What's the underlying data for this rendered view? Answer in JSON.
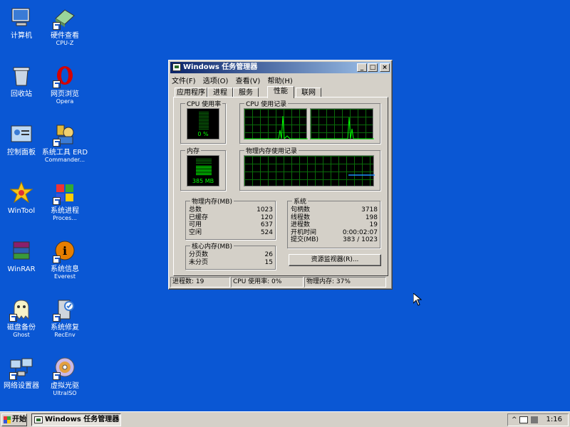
{
  "desktop_icons": [
    {
      "id": "computer",
      "label": "计算机",
      "sub": ""
    },
    {
      "id": "cpuz",
      "label": "硬件查看",
      "sub": "CPU-Z"
    },
    {
      "id": "recycle",
      "label": "回收站",
      "sub": ""
    },
    {
      "id": "opera",
      "label": "网页浏览",
      "sub": "Opera"
    },
    {
      "id": "control",
      "label": "控制面板",
      "sub": ""
    },
    {
      "id": "erd",
      "label": "系统工具 ERD",
      "sub": "Commander..."
    },
    {
      "id": "wintool",
      "label": "WinTool",
      "sub": ""
    },
    {
      "id": "proc",
      "label": "系统进程",
      "sub": "Proces..."
    },
    {
      "id": "winrar",
      "label": "WinRAR",
      "sub": ""
    },
    {
      "id": "everest",
      "label": "系统信息",
      "sub": "Everest"
    },
    {
      "id": "ghost",
      "label": "磁盘备份",
      "sub": "Ghost"
    },
    {
      "id": "recenv",
      "label": "系统修复",
      "sub": "RecEnv"
    },
    {
      "id": "network",
      "label": "网络设置器",
      "sub": ""
    },
    {
      "id": "ultraiso",
      "label": "虚拟光驱",
      "sub": "UltraISO"
    }
  ],
  "window": {
    "title": "Windows 任务管理器",
    "buttons": {
      "min": "_",
      "max": "□",
      "close": "×"
    },
    "menu": [
      "文件(F)",
      "选项(O)",
      "查看(V)",
      "帮助(H)"
    ],
    "tabs": [
      "应用程序",
      "进程",
      "服务",
      "性能",
      "联网"
    ],
    "active_tab": "性能",
    "cpu_usage": {
      "title": "CPU 使用率",
      "value": "0 %"
    },
    "cpu_history": {
      "title": "CPU 使用记录"
    },
    "memory": {
      "title": "内存",
      "value": "385 MB"
    },
    "mem_history": {
      "title": "物理内存使用记录"
    },
    "physical_memory": {
      "title": "物理内存(MB)",
      "rows": [
        {
          "k": "总数",
          "v": "1023"
        },
        {
          "k": "已缓存",
          "v": "120"
        },
        {
          "k": "可用",
          "v": "637"
        },
        {
          "k": "空闲",
          "v": "524"
        }
      ]
    },
    "system": {
      "title": "系统",
      "rows": [
        {
          "k": "句柄数",
          "v": "3718"
        },
        {
          "k": "线程数",
          "v": "198"
        },
        {
          "k": "进程数",
          "v": "19"
        },
        {
          "k": "开机时间",
          "v": "0:00:02:07"
        },
        {
          "k": "提交(MB)",
          "v": "383 / 1023"
        }
      ]
    },
    "kernel_memory": {
      "title": "核心内存(MB)",
      "rows": [
        {
          "k": "分页数",
          "v": "26"
        },
        {
          "k": "未分页",
          "v": "15"
        }
      ]
    },
    "resource_monitor_button": "资源监视器(R)...",
    "status": {
      "processes": "进程数: 19",
      "cpu": "CPU 使用率: 0%",
      "memory": "物理内存: 37%"
    }
  },
  "taskbar": {
    "start_label": "开始",
    "task_label": "Windows 任务管理器",
    "clock": "1:16"
  },
  "colors": {
    "desktop": "#0a57d4",
    "graph_line": "#00ff00",
    "memory_line": "#1e90ff"
  }
}
